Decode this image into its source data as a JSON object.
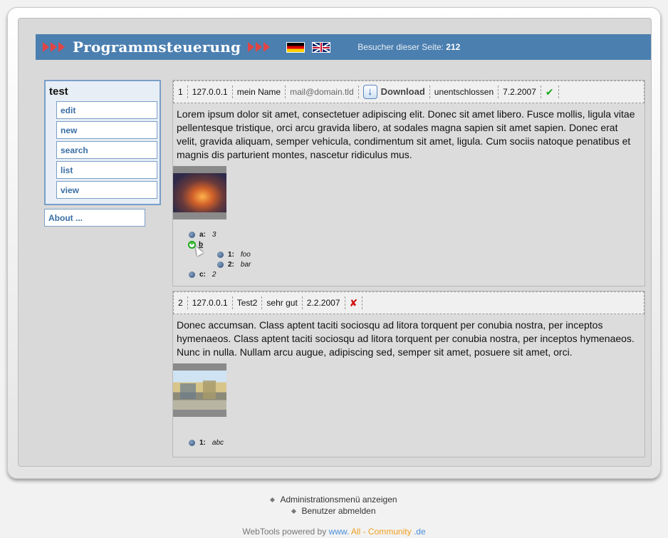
{
  "header": {
    "title": "Programmsteuerung",
    "visitors_label": "Besucher dieser Seite:",
    "visitors_count": "212",
    "flags": [
      "flag-de-icon",
      "flag-uk-icon"
    ]
  },
  "sidebar": {
    "title": "test",
    "items": [
      {
        "label": "edit"
      },
      {
        "label": "new"
      },
      {
        "label": "search"
      },
      {
        "label": "list"
      },
      {
        "label": "view"
      }
    ],
    "about": "About ..."
  },
  "entries": [
    {
      "id": "1",
      "ip": "127.0.0.1",
      "name": "mein Name",
      "email": "mail@domain.tld",
      "download": "Download",
      "status": "unentschlossen",
      "date": "7.2.2007",
      "ok": true,
      "text": "Lorem ipsum dolor sit amet, consectetuer adipiscing elit. Donec sit amet libero. Fusce mollis, ligula vitae pellentesque tristique, orci arcu gravida libero, at sodales magna sapien sit amet sapien. Donec erat velit, gravida aliquam, semper vehicula, condimentum sit amet, ligula. Cum sociis natoque penatibus et magnis dis parturient montes, nascetur ridiculus mus.",
      "tree": {
        "a_key": "a:",
        "a_val": "3",
        "b_key": "b",
        "b1_key": "1:",
        "b1_val": "foo",
        "b2_key": "2:",
        "b2_val": "bar",
        "c_key": "c:",
        "c_val": "2"
      }
    },
    {
      "id": "2",
      "ip": "127.0.0.1",
      "name": "Test2",
      "rating": "sehr gut",
      "date": "2.2.2007",
      "ok": false,
      "text": "Donec accumsan. Class aptent taciti sociosqu ad litora torquent per conubia nostra, per inceptos hymenaeos. Class aptent taciti sociosqu ad litora torquent per conubia nostra, per inceptos hymenaeos. Nunc in nulla. Nullam arcu augue, adipiscing sed, semper sit amet, posuere sit amet, orci.",
      "tree": {
        "k1": "1:",
        "v1": "abc"
      }
    }
  ],
  "footer": {
    "admin_menu": "Administrationsmenü anzeigen",
    "logout": "Benutzer abmelden",
    "powered_prefix": "WebTools powered by",
    "powered_www": "www.",
    "powered_all": "All - Community",
    "powered_de": ".de"
  },
  "colors": {
    "header_bg": "#4b7fb0",
    "accent_arrow": "#e04545",
    "link": "#3a6ea5",
    "ok": "#1aaa1a",
    "error": "#d01010"
  }
}
